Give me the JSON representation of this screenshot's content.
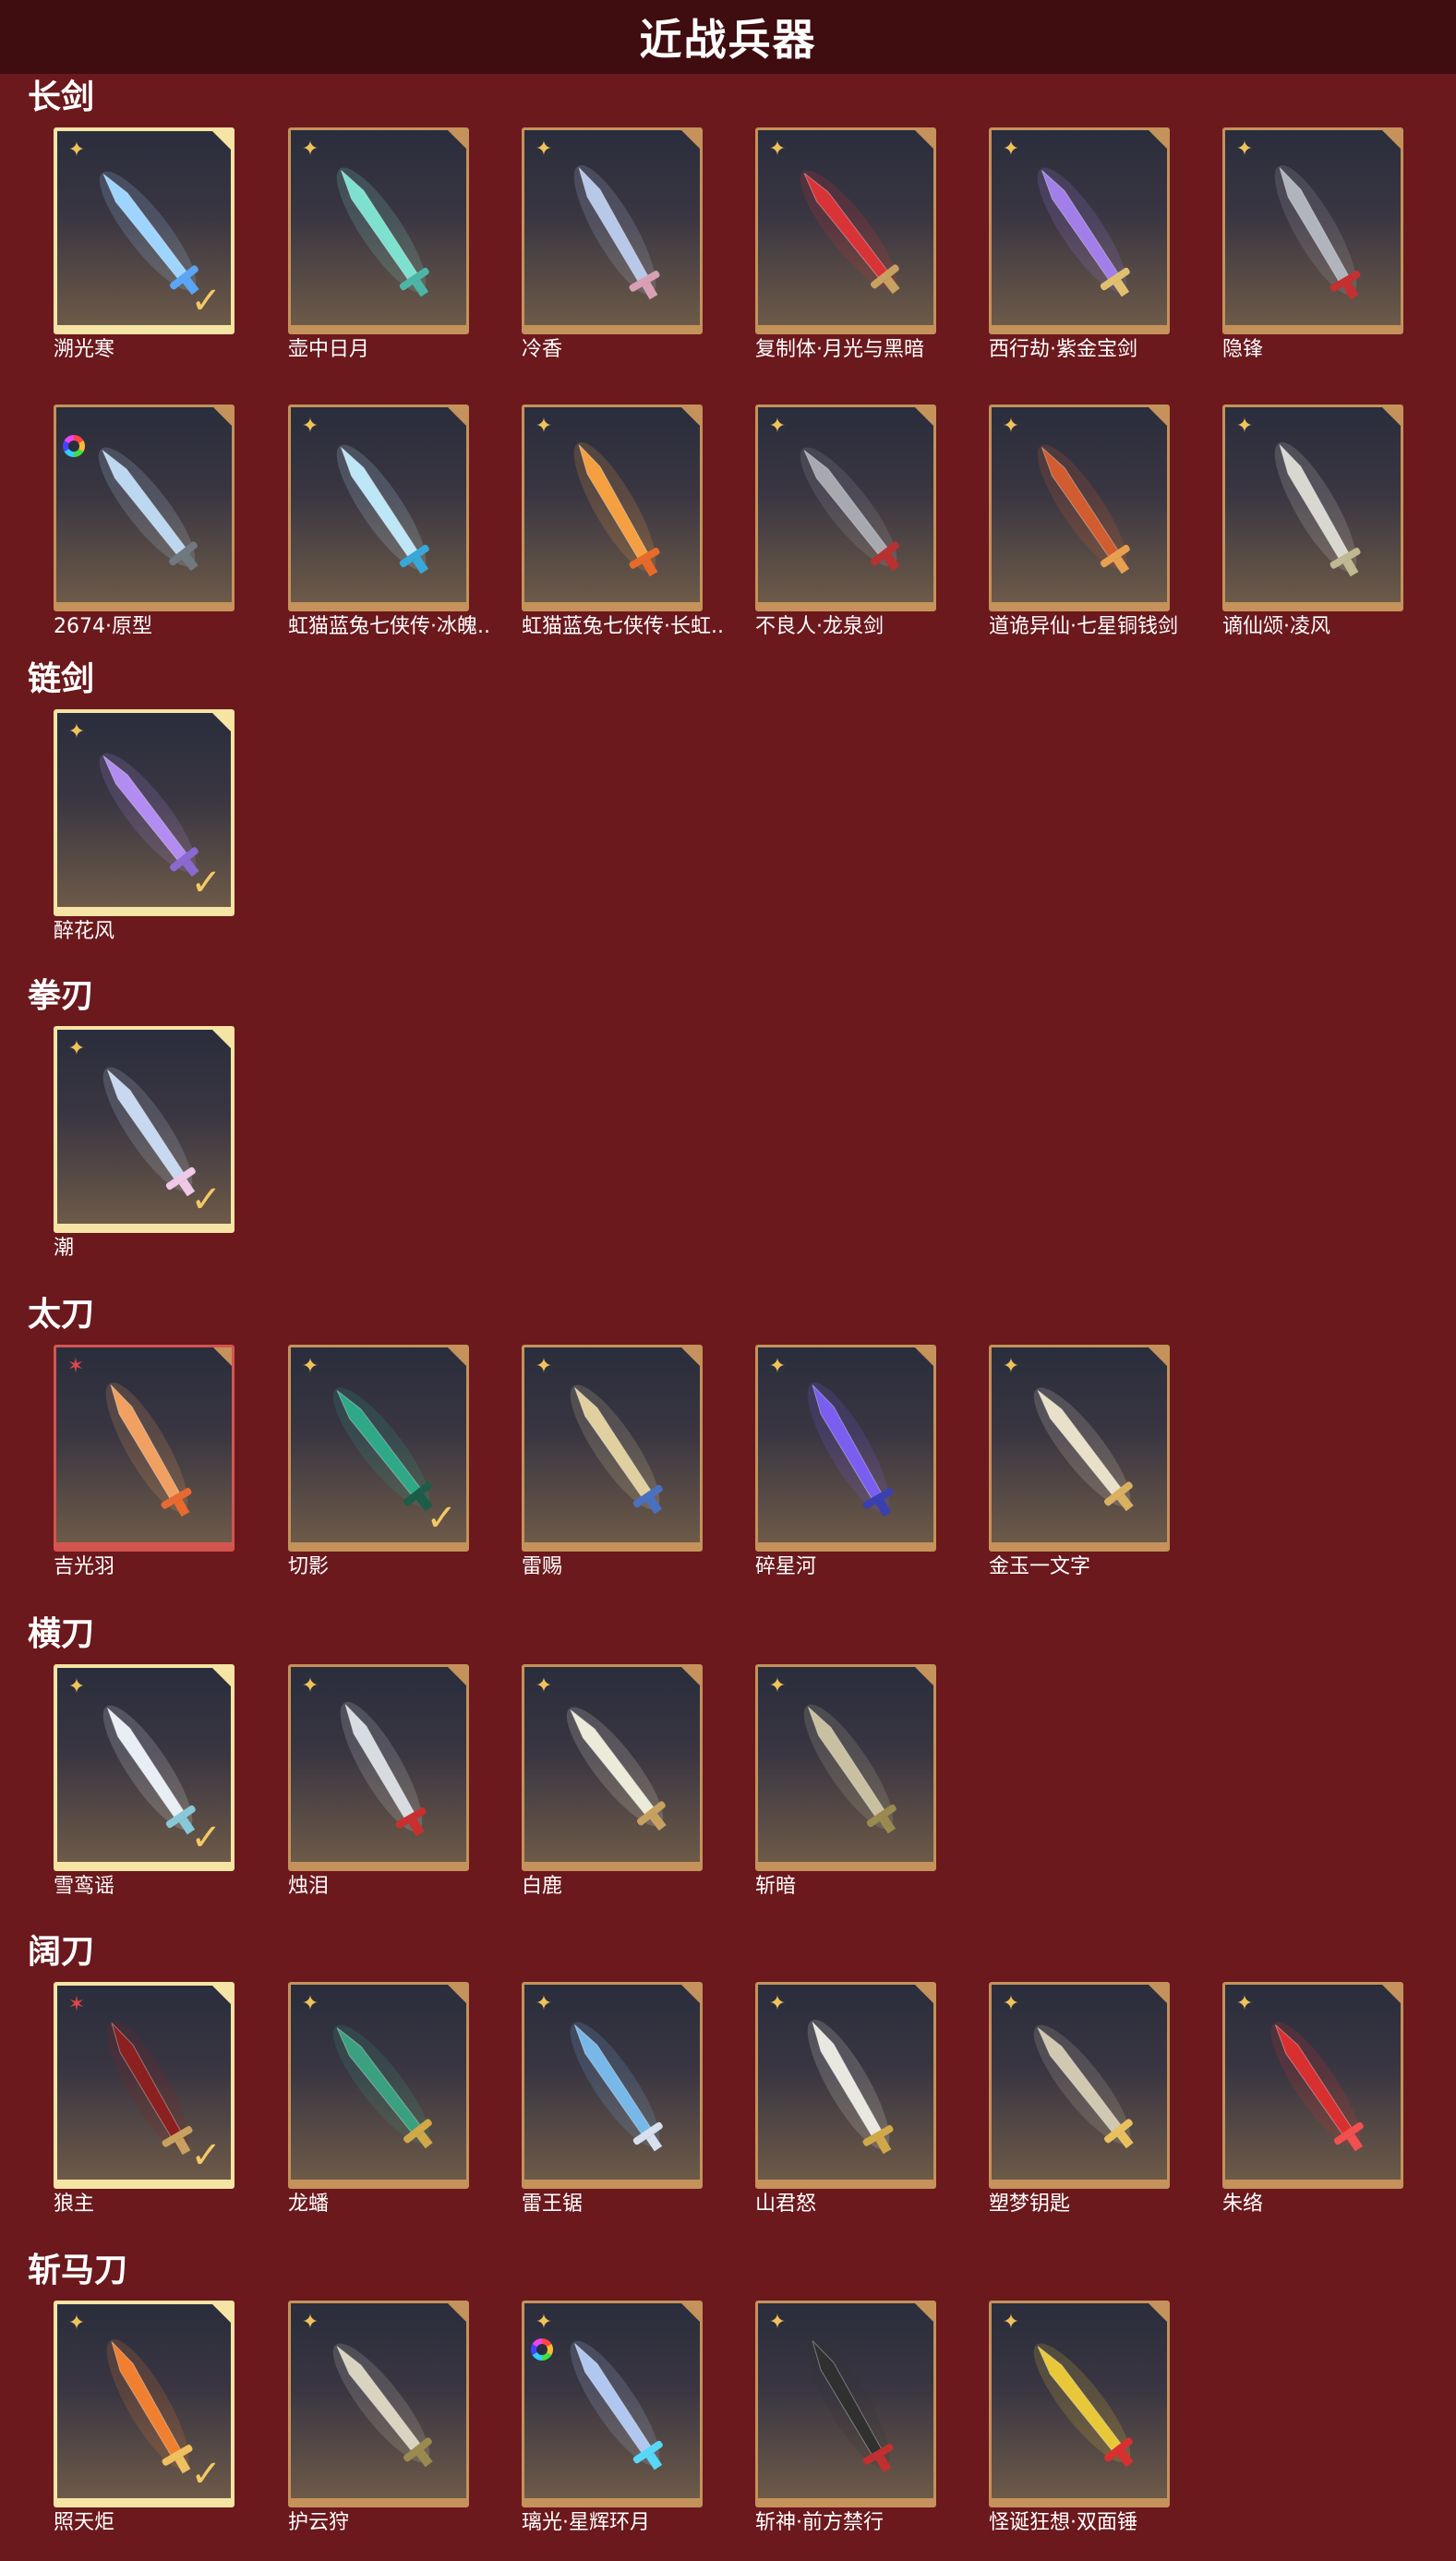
{
  "page_title": "近战兵器",
  "sections": [
    {
      "title": "长剑",
      "items": [
        {
          "name": "溯光寒",
          "badge": "gold",
          "selected": true,
          "blade": "#9fd4ff",
          "hilt": "#5aa6f5"
        },
        {
          "name": "壶中日月",
          "badge": "gold",
          "selected": false,
          "blade": "#7ee0cf",
          "hilt": "#4cb5a6"
        },
        {
          "name": "冷香",
          "badge": "gold",
          "selected": false,
          "blade": "#b8c8e8",
          "hilt": "#d9a0b4"
        },
        {
          "name": "复制体·月光与黑暗",
          "badge": "gold",
          "selected": false,
          "blade": "#d83438",
          "hilt": "#c8a060"
        },
        {
          "name": "西行劫·紫金宝剑",
          "badge": "gold",
          "selected": false,
          "blade": "#a27ee8",
          "hilt": "#e0c070"
        },
        {
          "name": "隐锋",
          "badge": "gold",
          "selected": false,
          "blade": "#b0b4bc",
          "hilt": "#c43030"
        },
        {
          "name": "2674·原型",
          "badge": "ring",
          "selected": false,
          "blade": "#bcd8f0",
          "hilt": "#707880"
        },
        {
          "name": "虹猫蓝兔七侠传·冰魄..",
          "badge": "gold",
          "selected": false,
          "blade": "#bde6f7",
          "hilt": "#38a8d8"
        },
        {
          "name": "虹猫蓝兔七侠传·长虹..",
          "badge": "gold",
          "selected": false,
          "blade": "#f4a040",
          "hilt": "#e86a2a"
        },
        {
          "name": "不良人·龙泉剑",
          "badge": "gold",
          "selected": false,
          "blade": "#a8a8b0",
          "hilt": "#b83030"
        },
        {
          "name": "道诡异仙·七星铜钱剑",
          "badge": "gold",
          "selected": false,
          "blade": "#d05c30",
          "hilt": "#e8a050"
        },
        {
          "name": "谪仙颂·凌风",
          "badge": "gold",
          "selected": false,
          "blade": "#d8d8d0",
          "hilt": "#c0b890"
        }
      ]
    },
    {
      "title": "链剑",
      "items": [
        {
          "name": "醉花风",
          "badge": "gold",
          "selected": true,
          "blade": "#b28cf0",
          "hilt": "#8a6ad0"
        }
      ]
    },
    {
      "title": "拳刃",
      "items": [
        {
          "name": "潮",
          "badge": "gold",
          "selected": true,
          "blade": "#c8d8f0",
          "hilt": "#f0c8e8"
        }
      ]
    },
    {
      "title": "太刀",
      "items": [
        {
          "name": "吉光羽",
          "badge": "red",
          "selected": false,
          "rarity": "red",
          "blade": "#f0a060",
          "hilt": "#e86a30"
        },
        {
          "name": "切影",
          "badge": "gold",
          "selected": true,
          "check_only": true,
          "blade": "#2fa888",
          "hilt": "#1c5c48"
        },
        {
          "name": "雷赐",
          "badge": "gold",
          "selected": false,
          "blade": "#e0d0a0",
          "hilt": "#4a70c0"
        },
        {
          "name": "碎星河",
          "badge": "gold",
          "selected": false,
          "blade": "#7a5ef0",
          "hilt": "#3a40b0"
        },
        {
          "name": "金玉一文字",
          "badge": "gold",
          "selected": false,
          "blade": "#e8e0c8",
          "hilt": "#d8b060"
        }
      ]
    },
    {
      "title": "横刀",
      "items": [
        {
          "name": "雪鸾谣",
          "badge": "gold",
          "selected": true,
          "blade": "#e8eef4",
          "hilt": "#88c8d8"
        },
        {
          "name": "烛泪",
          "badge": "gold",
          "selected": false,
          "blade": "#d8dce0",
          "hilt": "#c83030"
        },
        {
          "name": "白鹿",
          "badge": "gold",
          "selected": false,
          "blade": "#ecead8",
          "hilt": "#c8a060"
        },
        {
          "name": "斩暗",
          "badge": "gold",
          "selected": false,
          "blade": "#c8c0a0",
          "hilt": "#9a8a50"
        }
      ]
    },
    {
      "title": "阔刀",
      "items": [
        {
          "name": "狼主",
          "badge": "red",
          "selected": true,
          "blade": "#8a2020",
          "hilt": "#c8a060"
        },
        {
          "name": "龙蟠",
          "badge": "gold",
          "selected": false,
          "blade": "#3aa080",
          "hilt": "#d0a848"
        },
        {
          "name": "雷王锯",
          "badge": "gold",
          "selected": false,
          "blade": "#78b8e8",
          "hilt": "#d8e0f0"
        },
        {
          "name": "山君怒",
          "badge": "gold",
          "selected": false,
          "blade": "#e8e8e0",
          "hilt": "#d0a848"
        },
        {
          "name": "塑梦钥匙",
          "badge": "gold",
          "selected": false,
          "blade": "#d0c8b0",
          "hilt": "#e8c060"
        },
        {
          "name": "朱络",
          "badge": "gold",
          "selected": false,
          "blade": "#d83030",
          "hilt": "#f05050"
        }
      ]
    },
    {
      "title": "斩马刀",
      "items": [
        {
          "name": "照天炬",
          "badge": "gold",
          "selected": true,
          "blade": "#f08030",
          "hilt": "#f0c060"
        },
        {
          "name": "护云狩",
          "badge": "gold",
          "selected": false,
          "blade": "#d8d4c0",
          "hilt": "#9a8a50"
        },
        {
          "name": "璃光·星辉环月",
          "badge": "ring",
          "badge2": "gold",
          "selected": false,
          "blade": "#b0c8f0",
          "hilt": "#58d8f8"
        },
        {
          "name": "斩神·前方禁行",
          "badge": "gold",
          "selected": false,
          "blade": "#303030",
          "hilt": "#c03030"
        },
        {
          "name": "怪诞狂想·双面锤",
          "badge": "gold",
          "selected": false,
          "blade": "#e8c838",
          "hilt": "#d83030"
        }
      ]
    }
  ],
  "icons": {
    "gold_badge": "✦",
    "red_badge": "✶",
    "check": "✓"
  }
}
